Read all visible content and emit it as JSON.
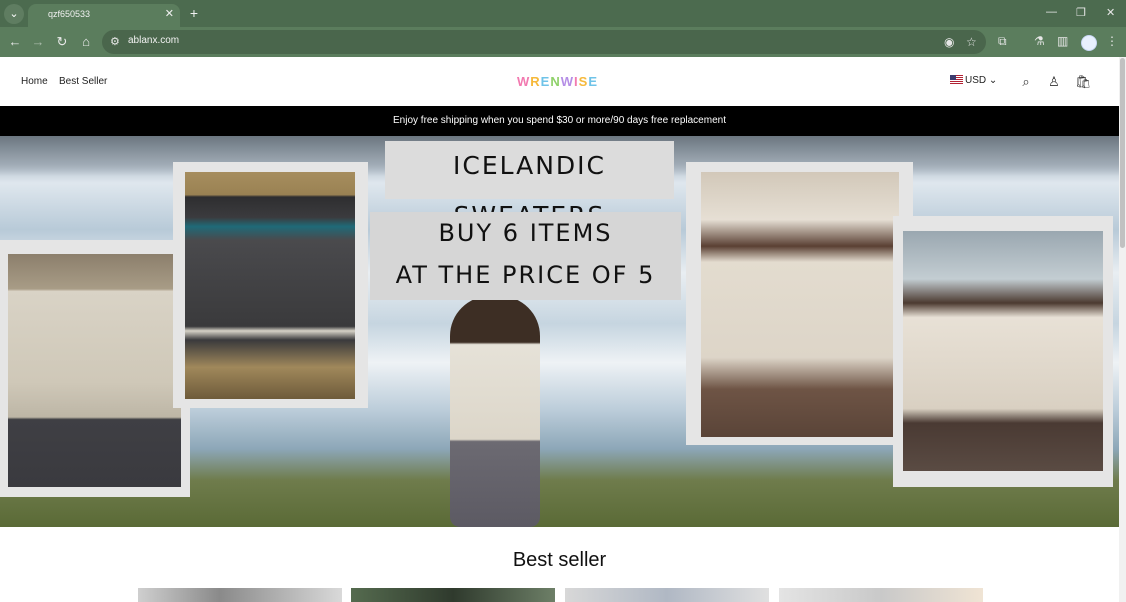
{
  "browser": {
    "tab_title": "qzf650533",
    "url": "ablanx.com",
    "icons": {
      "tab_search": "chevron-down-icon",
      "new_tab": "+",
      "close": "×"
    }
  },
  "site": {
    "nav": [
      "Home",
      "Best Seller"
    ],
    "logo": "WRENWISE",
    "logo_colors": [
      "#f27ab0",
      "#f6b93b",
      "#6fc3e8",
      "#8fd16a",
      "#b58ee6",
      "#f27ab0",
      "#f6b93b",
      "#6fc3e8"
    ],
    "currency": "USD",
    "announcement": "Enjoy free shipping when you spend $30 or more/90 days free replacement"
  },
  "hero": {
    "headline": "ICELANDIC SWEATERS",
    "promo_line1": "BUY 6 ITEMS",
    "promo_line2": "AT THE PRICE OF 5"
  },
  "section": {
    "title": "Best seller"
  },
  "colors": {
    "tab_strip": "#4c6b4f",
    "toolbar": "#5b7d5d",
    "announcement_bg": "#000000"
  }
}
